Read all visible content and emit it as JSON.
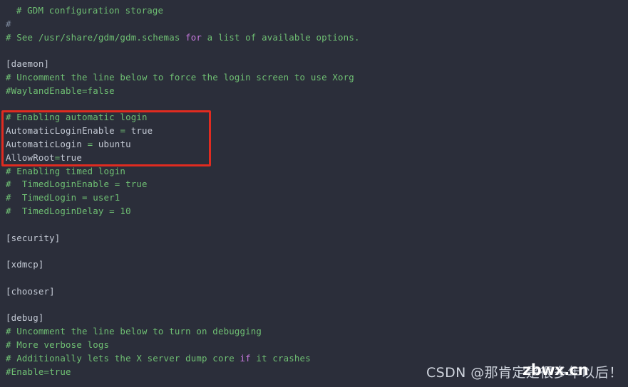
{
  "editor": {
    "file_kind": "gdm-custom-conf",
    "background_color": "#2b2e3a",
    "comment_color": "#6fbf73",
    "keyword_color": "#c678dd",
    "plain_color": "#c3c9d4",
    "highlight_border_color": "#e02b20",
    "lines": [
      {
        "id": "l1",
        "indent": 2,
        "parts": [
          {
            "text": "# GDM configuration storage",
            "cls": "c-comment"
          }
        ]
      },
      {
        "id": "l2",
        "indent": 0,
        "parts": [
          {
            "text": "#",
            "cls": "c-hash"
          }
        ]
      },
      {
        "id": "l3",
        "indent": 0,
        "parts": [
          {
            "text": "# See /usr/share/gdm/gdm.schemas ",
            "cls": "c-comment"
          },
          {
            "text": "for",
            "cls": "c-keyword"
          },
          {
            "text": " a list of available options.",
            "cls": "c-comment"
          }
        ]
      },
      {
        "id": "l4",
        "indent": 0,
        "parts": [
          {
            "text": "",
            "cls": "c-plain"
          }
        ]
      },
      {
        "id": "l5",
        "indent": 0,
        "parts": [
          {
            "text": "[daemon]",
            "cls": "c-section"
          }
        ]
      },
      {
        "id": "l6",
        "indent": 0,
        "parts": [
          {
            "text": "# Uncomment the line below to force the login screen to use Xorg",
            "cls": "c-comment"
          }
        ]
      },
      {
        "id": "l7",
        "indent": 0,
        "parts": [
          {
            "text": "#WaylandEnable=false",
            "cls": "c-comment"
          }
        ]
      },
      {
        "id": "l8",
        "indent": 0,
        "parts": [
          {
            "text": "",
            "cls": "c-plain"
          }
        ]
      },
      {
        "id": "l9",
        "indent": 0,
        "parts": [
          {
            "text": "# Enabling automatic login",
            "cls": "c-comment"
          }
        ]
      },
      {
        "id": "l10",
        "indent": 0,
        "parts": [
          {
            "text": "AutomaticLoginEnable ",
            "cls": "c-plain"
          },
          {
            "text": "=",
            "cls": "c-op"
          },
          {
            "text": " true",
            "cls": "c-plain"
          }
        ]
      },
      {
        "id": "l11",
        "indent": 0,
        "parts": [
          {
            "text": "AutomaticLogin ",
            "cls": "c-plain"
          },
          {
            "text": "=",
            "cls": "c-op"
          },
          {
            "text": " ubuntu",
            "cls": "c-plain"
          }
        ]
      },
      {
        "id": "l12",
        "indent": 0,
        "parts": [
          {
            "text": "AllowRoot",
            "cls": "c-plain"
          },
          {
            "text": "=",
            "cls": "c-op"
          },
          {
            "text": "true",
            "cls": "c-plain"
          }
        ]
      },
      {
        "id": "l13",
        "indent": 0,
        "parts": [
          {
            "text": "# Enabling timed login",
            "cls": "c-comment"
          }
        ]
      },
      {
        "id": "l14",
        "indent": 0,
        "parts": [
          {
            "text": "#  TimedLoginEnable = true",
            "cls": "c-comment"
          }
        ]
      },
      {
        "id": "l15",
        "indent": 0,
        "parts": [
          {
            "text": "#  TimedLogin = user1",
            "cls": "c-comment"
          }
        ]
      },
      {
        "id": "l16",
        "indent": 0,
        "parts": [
          {
            "text": "#  TimedLoginDelay = 10",
            "cls": "c-comment"
          }
        ]
      },
      {
        "id": "l17",
        "indent": 0,
        "parts": [
          {
            "text": "",
            "cls": "c-plain"
          }
        ]
      },
      {
        "id": "l18",
        "indent": 0,
        "parts": [
          {
            "text": "[security]",
            "cls": "c-section"
          }
        ]
      },
      {
        "id": "l19",
        "indent": 0,
        "parts": [
          {
            "text": "",
            "cls": "c-plain"
          }
        ]
      },
      {
        "id": "l20",
        "indent": 0,
        "parts": [
          {
            "text": "[xdmcp]",
            "cls": "c-section"
          }
        ]
      },
      {
        "id": "l21",
        "indent": 0,
        "parts": [
          {
            "text": "",
            "cls": "c-plain"
          }
        ]
      },
      {
        "id": "l22",
        "indent": 0,
        "parts": [
          {
            "text": "[chooser]",
            "cls": "c-section"
          }
        ]
      },
      {
        "id": "l23",
        "indent": 0,
        "parts": [
          {
            "text": "",
            "cls": "c-plain"
          }
        ]
      },
      {
        "id": "l24",
        "indent": 0,
        "parts": [
          {
            "text": "[debug]",
            "cls": "c-section"
          }
        ]
      },
      {
        "id": "l25",
        "indent": 0,
        "parts": [
          {
            "text": "# Uncomment the line below to turn on debugging",
            "cls": "c-comment"
          }
        ]
      },
      {
        "id": "l26",
        "indent": 0,
        "parts": [
          {
            "text": "# More verbose logs",
            "cls": "c-comment"
          }
        ]
      },
      {
        "id": "l27",
        "indent": 0,
        "parts": [
          {
            "text": "# Additionally lets the X server dump core ",
            "cls": "c-comment"
          },
          {
            "text": "if",
            "cls": "c-keyword"
          },
          {
            "text": " it crashes",
            "cls": "c-comment"
          }
        ]
      },
      {
        "id": "l28",
        "indent": 0,
        "parts": [
          {
            "text": "#Enable=true",
            "cls": "c-comment"
          }
        ]
      }
    ]
  },
  "highlight": {
    "label": "automatic-login-block",
    "covers_lines": [
      "# Enabling automatic login",
      "AutomaticLoginEnable = true",
      "AutomaticLogin = ubuntu",
      "AllowRoot=true"
    ]
  },
  "watermark": {
    "text": "CSDN @那肯定是很多年以后！",
    "overlay_text": "zbwx.cn"
  }
}
